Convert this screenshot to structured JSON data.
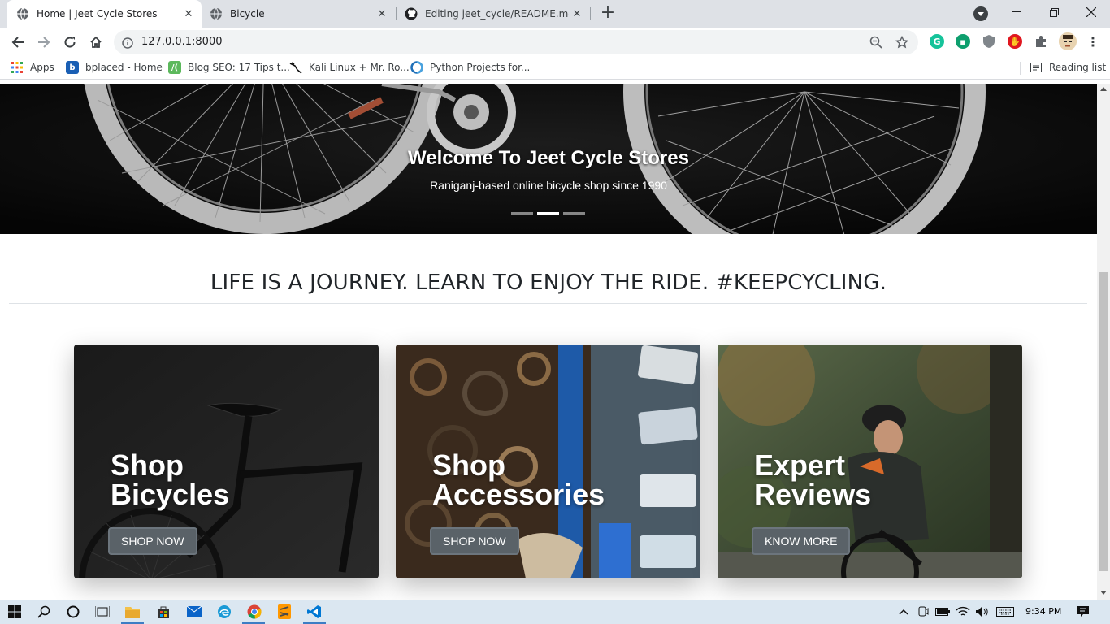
{
  "browser": {
    "tabs": [
      {
        "title": "Home | Jeet Cycle Stores",
        "active": true
      },
      {
        "title": "Bicycle",
        "active": false
      },
      {
        "title": "Editing jeet_cycle/README.md at",
        "active": false
      }
    ],
    "url": "127.0.0.1:8000",
    "bookmarks": [
      {
        "label": "Apps",
        "icon": "apps-grid-icon"
      },
      {
        "label": "bplaced - Home",
        "icon": "bplaced-icon"
      },
      {
        "label": "Blog SEO: 17 Tips t...",
        "icon": "hubspot-icon"
      },
      {
        "label": "Kali Linux + Mr. Ro...",
        "icon": "kali-dragon-icon"
      },
      {
        "label": "Python Projects for...",
        "icon": "python-projects-icon"
      }
    ],
    "reading_list": "Reading list"
  },
  "hero": {
    "title": "Welcome To Jeet Cycle Stores",
    "subtitle": "Raniganj-based online bicycle shop since 1990",
    "slides": 3,
    "active_slide": 2
  },
  "tagline": "LIFE IS A JOURNEY. LEARN TO ENJOY THE RIDE. #KEEPCYCLING.",
  "cards": [
    {
      "title": "Shop\nBicycles",
      "button": "SHOP NOW"
    },
    {
      "title": "Shop\nAccessories",
      "button": "SHOP NOW"
    },
    {
      "title": "Expert\nReviews",
      "button": "KNOW MORE"
    }
  ],
  "taskbar": {
    "clock": "9:34 PM"
  },
  "colors": {
    "button_bg": "#5a6268",
    "text_dark": "#212529",
    "accent_blue": "#1a73e8"
  }
}
